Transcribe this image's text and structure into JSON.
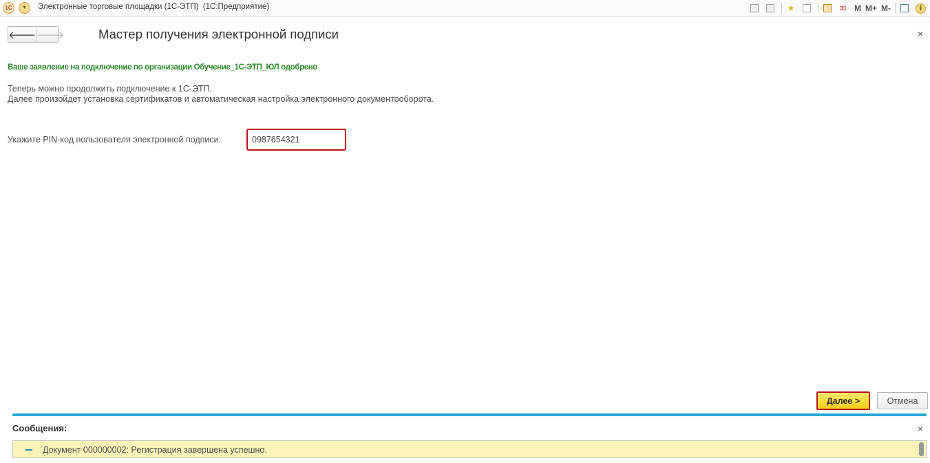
{
  "window": {
    "logo_text": "1С",
    "app_title": "Электронные торговые площадки (1С-ЭТП)  (1С:Предприятие)",
    "toolbar_memory_labels": [
      "M",
      "M+",
      "M-"
    ],
    "calendar_day": "31",
    "info_symbol": "i"
  },
  "form": {
    "title": "Мастер получения электронной подписи",
    "close_symbol": "×",
    "back_symbol": "🡐",
    "forward_symbol": "🡒",
    "approved_text": "Ваше заявление на подключение по организации Обучение_1С-ЭТП_ЮЛ одобрено",
    "info_line1": "Теперь можно продолжить подключение к 1С-ЭТП.",
    "info_line2": "Далее произойдет установка сертификатов и автоматическая настройка электронного документооборота.",
    "pin_label": "Укажите PIN-код пользователя электронной подписи:",
    "pin_value": "0987654321",
    "next_label": "Далее >",
    "cancel_label": "Отмена"
  },
  "messages": {
    "title": "Сообщения:",
    "close_symbol": "×",
    "items": [
      {
        "text": "Документ 000000002: Регистрация завершена успешно."
      }
    ]
  },
  "colors": {
    "approved_text": "#2d8a2d",
    "highlight_border": "#c1121c",
    "next_button_bg": "#f7cf17",
    "messages_divider": "#26a9d6",
    "message_row_bg": "#fcf3b8"
  }
}
